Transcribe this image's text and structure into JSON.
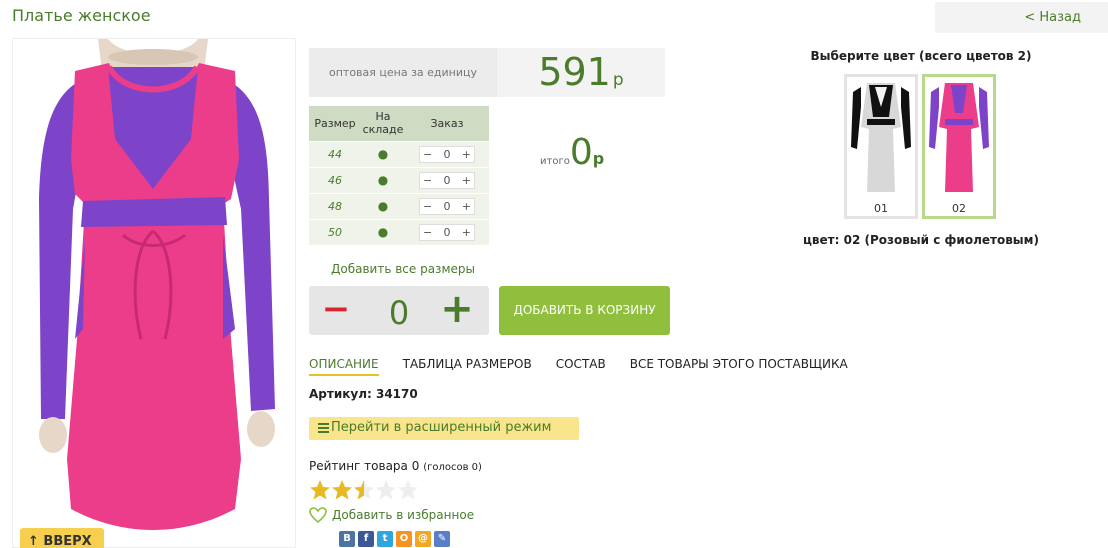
{
  "page": {
    "title": "Платье женское",
    "back_label": "< Назад",
    "up_label": "↑ ВВЕРХ"
  },
  "price": {
    "label": "оптовая цена за единицу",
    "value": "591",
    "currency": "р"
  },
  "sizes": {
    "headers": [
      "Размер",
      "На складе",
      "Заказ"
    ],
    "rows": [
      {
        "size": "44",
        "stock": "●",
        "qty": "0"
      },
      {
        "size": "46",
        "stock": "●",
        "qty": "0"
      },
      {
        "size": "48",
        "stock": "●",
        "qty": "0"
      },
      {
        "size": "50",
        "stock": "●",
        "qty": "0"
      }
    ]
  },
  "total": {
    "label": "итого",
    "value": "0",
    "currency": "р"
  },
  "add_all_label": "Добавить все размеры",
  "quantity": {
    "minus": "−",
    "value": "0",
    "plus": "+"
  },
  "cart_button": "ДОБАВИТЬ В КОРЗИНУ",
  "tabs": [
    {
      "label": "ОПИСАНИЕ",
      "active": true
    },
    {
      "label": "ТАБЛИЦА РАЗМЕРОВ",
      "active": false
    },
    {
      "label": "СОСТАВ",
      "active": false
    },
    {
      "label": "ВСЕ ТОВАРЫ ЭТОГО ПОСТАВЩИКА",
      "active": false
    }
  ],
  "sku": "Артикул: 34170",
  "extended_mode": "Перейти в расширенный режим",
  "rating": {
    "label": "Рейтинг товара 0",
    "votes": "(голосов 0)",
    "stars": 2.5
  },
  "favorite_label": "Добавить в избранное",
  "social": [
    "В",
    "f",
    "t",
    "О",
    "@",
    "✎"
  ],
  "colors": {
    "title": "Выберите цвет (всего цветов 2)",
    "items": [
      {
        "num": "01",
        "selected": false
      },
      {
        "num": "02",
        "selected": true
      }
    ],
    "selected_label": "цвет: 02 (Розовый с фиолетовым)"
  },
  "accent": "#4a7c2c",
  "brand_button": "#8fbf3d"
}
